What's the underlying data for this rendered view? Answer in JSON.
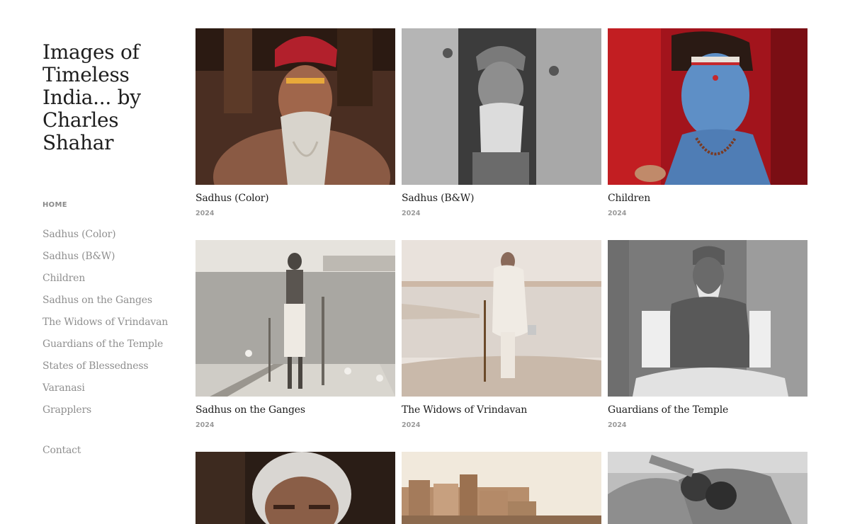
{
  "site": {
    "title": "Images of Timeless India... by Charles Shahar"
  },
  "nav": {
    "home": "HOME",
    "items": [
      "Sadhus (Color)",
      "Sadhus (B&W)",
      "Children",
      "Sadhus on the Ganges",
      "The Widows of Vrindavan",
      "Guardians of the Temple",
      "States of Blessedness",
      "Varanasi",
      "Grapplers"
    ],
    "contact": "Contact"
  },
  "galleries": [
    {
      "title": "Sadhus (Color)",
      "year": "2024",
      "image": "sadhu-red-turban-portrait"
    },
    {
      "title": "Sadhus (B&W)",
      "year": "2024",
      "image": "sadhu-bw-doorway-portrait"
    },
    {
      "title": "Children",
      "year": "2024",
      "image": "blue-painted-child-portrait"
    },
    {
      "title": "Sadhus on the Ganges",
      "year": "2024",
      "image": "sadhu-standing-on-boat"
    },
    {
      "title": "The Widows of Vrindavan",
      "year": "2024",
      "image": "widow-with-cane-by-river"
    },
    {
      "title": "Guardians of the Temple",
      "year": "2024",
      "image": "elder-seated-temple-doorway"
    },
    {
      "title": "States of Blessedness",
      "year": "",
      "image": "elder-white-hair-closeup"
    },
    {
      "title": "Varanasi",
      "year": "",
      "image": "varanasi-ghats-skyline"
    },
    {
      "title": "Grapplers",
      "year": "",
      "image": "wrestlers-grappling"
    }
  ]
}
